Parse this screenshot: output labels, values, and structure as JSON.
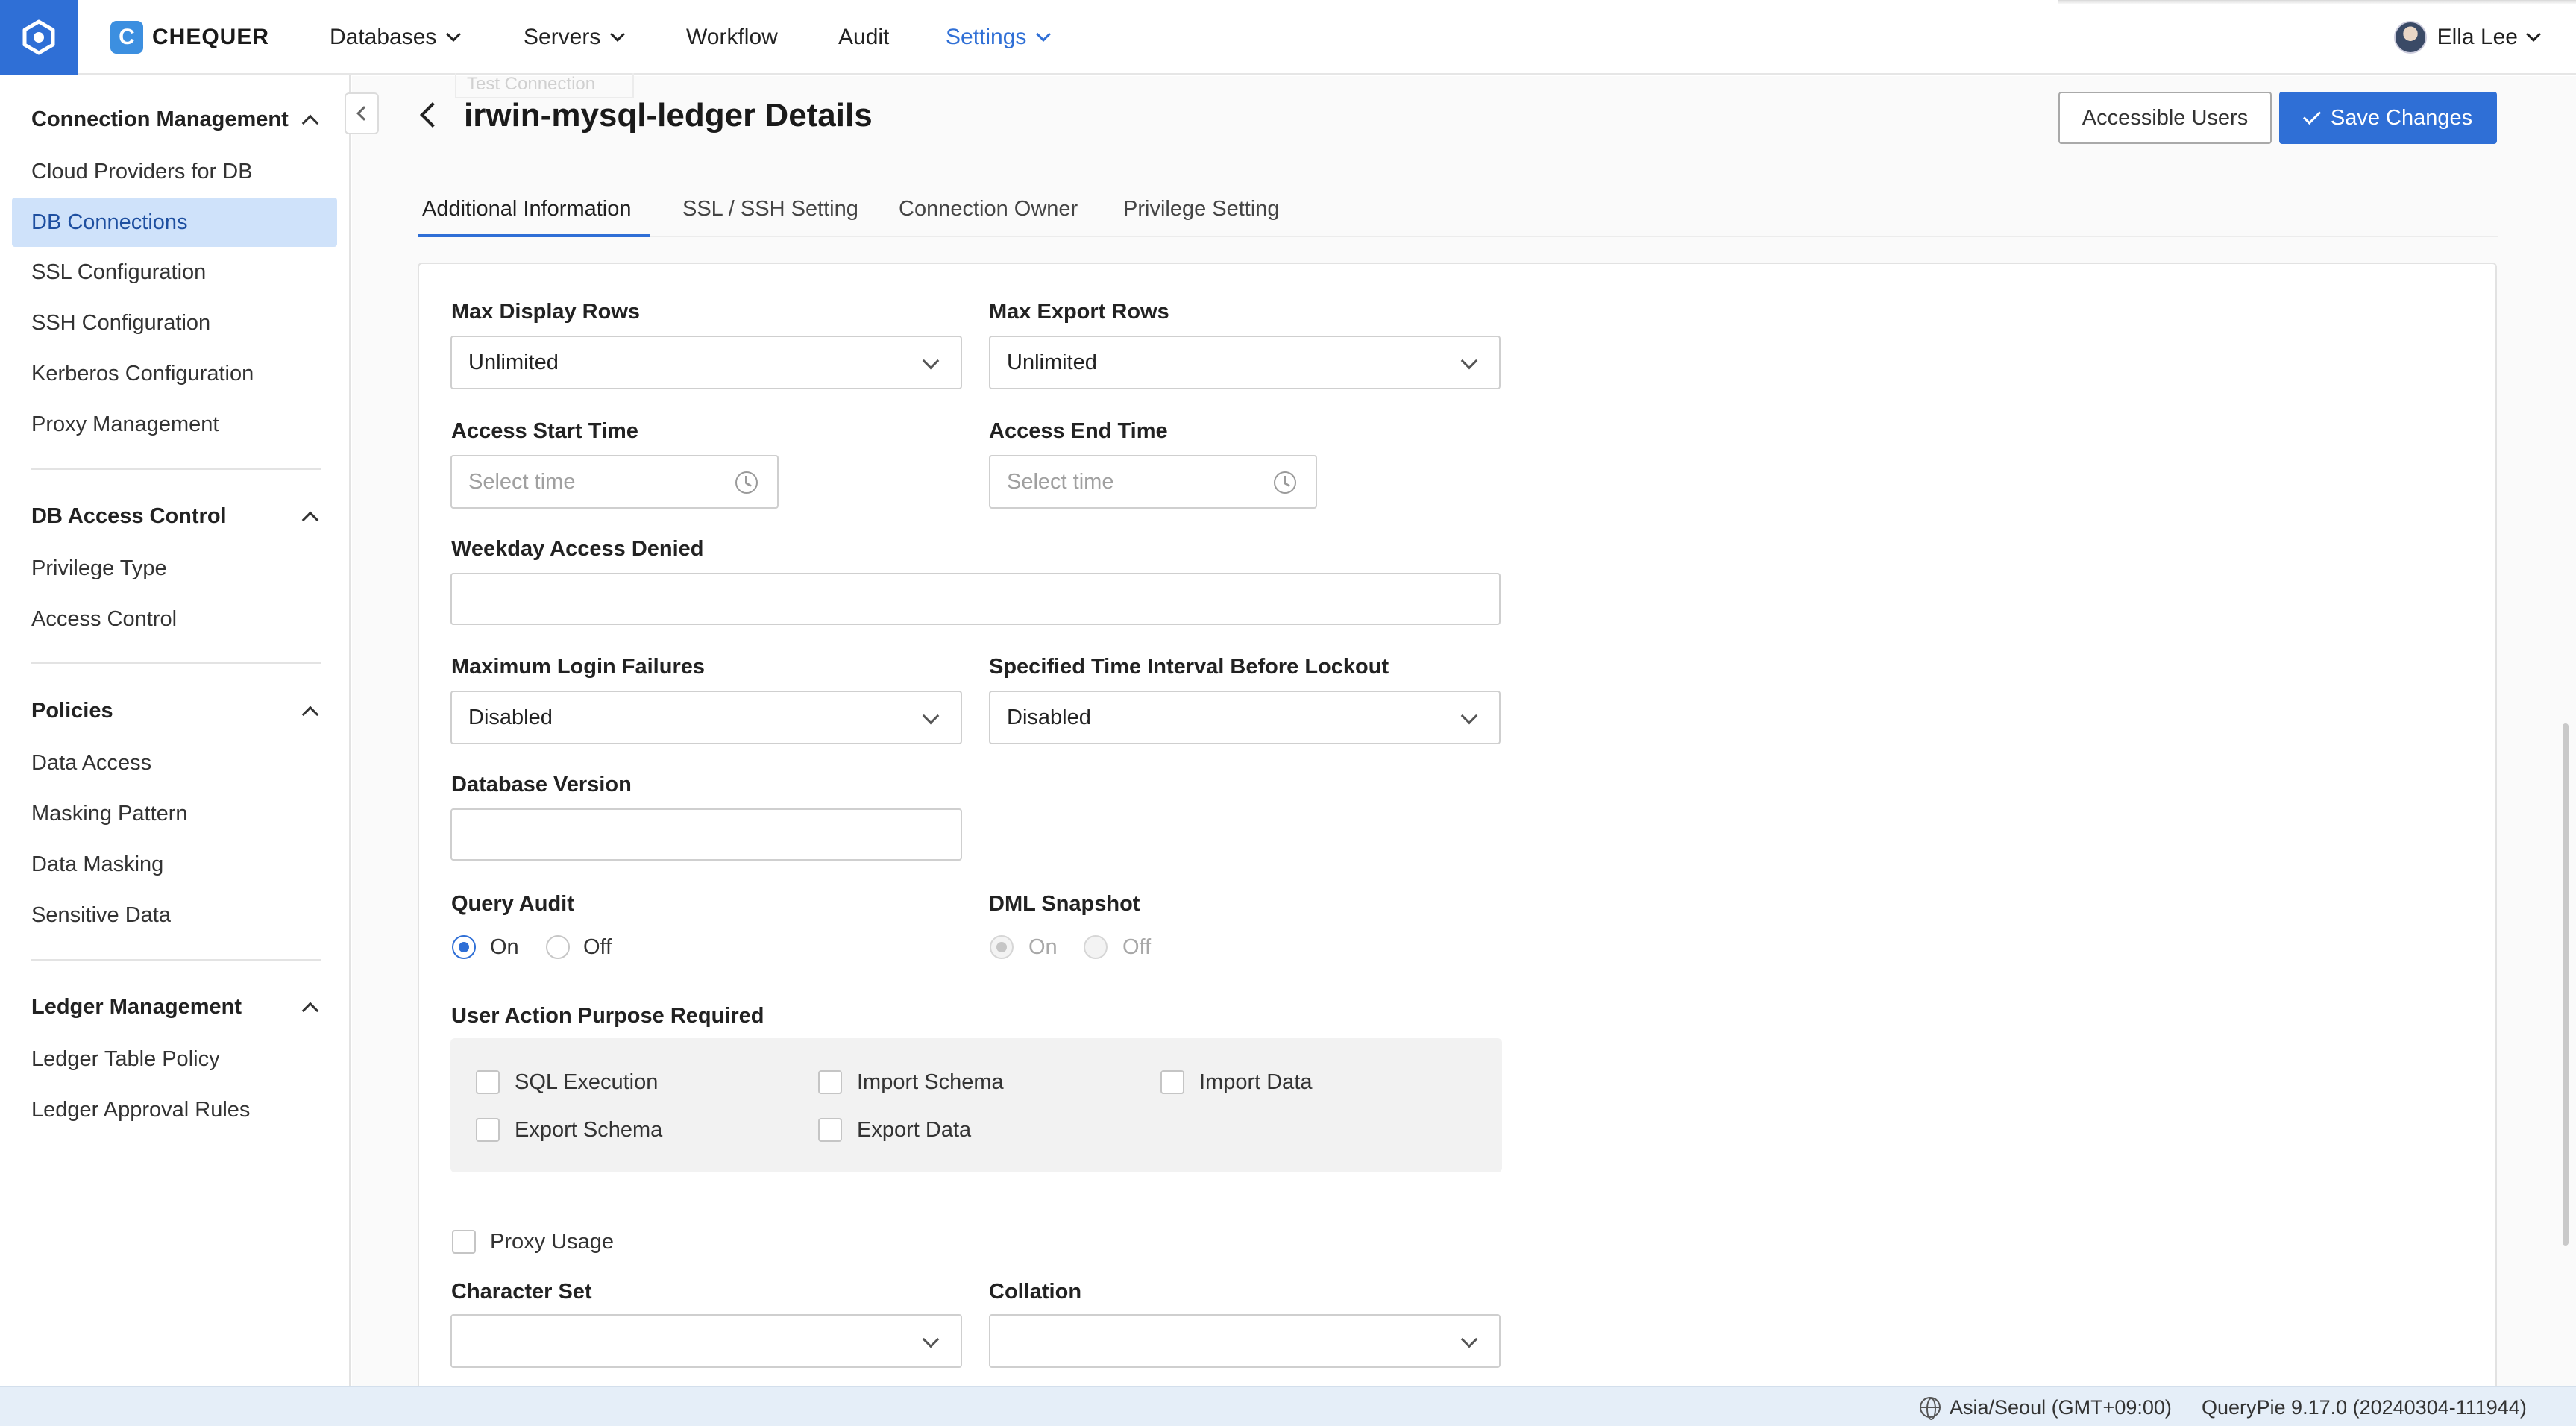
{
  "topbar": {
    "brand_letter": "C",
    "brand_name": "CHEQUER",
    "nav": [
      {
        "label": "Databases",
        "has_dropdown": true
      },
      {
        "label": "Servers",
        "has_dropdown": true
      },
      {
        "label": "Workflow",
        "has_dropdown": false
      },
      {
        "label": "Audit",
        "has_dropdown": false
      },
      {
        "label": "Settings",
        "has_dropdown": true,
        "active": true
      }
    ],
    "user_name": "Ella Lee",
    "accent_color": "#2f6fd6"
  },
  "sidebar": {
    "sections": [
      {
        "title": "Connection Management",
        "items": [
          "Cloud Providers for DB",
          "DB Connections",
          "SSL Configuration",
          "SSH Configuration",
          "Kerberos Configuration",
          "Proxy Management"
        ]
      },
      {
        "title": "DB Access Control",
        "items": [
          "Privilege Type",
          "Access Control"
        ]
      },
      {
        "title": "Policies",
        "items": [
          "Data Access",
          "Masking Pattern",
          "Data Masking",
          "Sensitive Data"
        ]
      },
      {
        "title": "Ledger Management",
        "items": [
          "Ledger Table Policy",
          "Ledger Approval Rules"
        ]
      }
    ],
    "selected_item": "DB Connections"
  },
  "page": {
    "ghost_button": "Test Connection",
    "title": "irwin-mysql-ledger Details",
    "accessible_users_button": "Accessible Users",
    "save_button": "Save Changes",
    "tabs": [
      "Additional Information",
      "SSL / SSH Setting",
      "Connection Owner",
      "Privilege Setting"
    ],
    "active_tab": "Additional Information"
  },
  "form": {
    "max_display_rows": {
      "label": "Max Display Rows",
      "value": "Unlimited"
    },
    "max_export_rows": {
      "label": "Max Export Rows",
      "value": "Unlimited"
    },
    "access_start_time": {
      "label": "Access Start Time",
      "placeholder": "Select time"
    },
    "access_end_time": {
      "label": "Access End Time",
      "placeholder": "Select time"
    },
    "weekday_access_denied": {
      "label": "Weekday Access Denied",
      "value": ""
    },
    "max_login_failures": {
      "label": "Maximum Login Failures",
      "value": "Disabled"
    },
    "lockout_interval": {
      "label": "Specified Time Interval Before Lockout",
      "value": "Disabled"
    },
    "database_version": {
      "label": "Database Version",
      "value": ""
    },
    "query_audit": {
      "label": "Query Audit",
      "on": "On",
      "off": "Off",
      "selected": "On"
    },
    "dml_snapshot": {
      "label": "DML Snapshot",
      "on": "On",
      "off": "Off",
      "selected": "On",
      "disabled": true
    },
    "user_action_purpose": {
      "label": "User Action Purpose Required",
      "options": [
        "SQL Execution",
        "Import Schema",
        "Import Data",
        "Export Schema",
        "Export Data"
      ]
    },
    "proxy_usage": {
      "label": "Proxy Usage",
      "checked": false
    },
    "character_set": {
      "label": "Character Set",
      "value": ""
    },
    "collation": {
      "label": "Collation",
      "value": ""
    }
  },
  "footer": {
    "timezone": "Asia/Seoul (GMT+09:00)",
    "version": "QueryPie 9.17.0 (20240304-111944)"
  }
}
